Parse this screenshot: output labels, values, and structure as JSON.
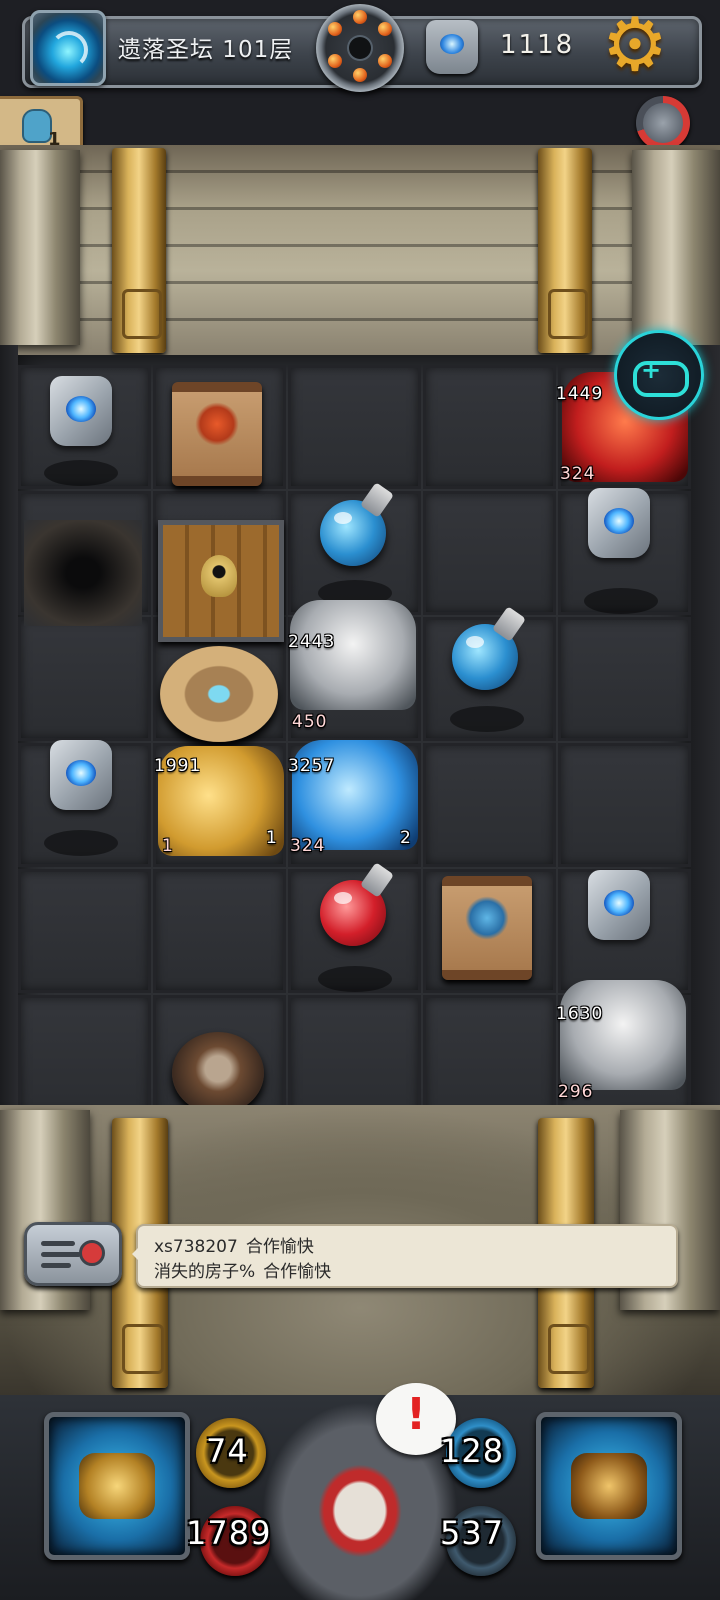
{
  "hud": {
    "floor_title": "遗落圣坛 101层",
    "coins": "1118",
    "party_count": "1"
  },
  "board": {
    "monsters": [
      {
        "id": "red-demon",
        "hp": "1449",
        "atk": "324"
      },
      {
        "id": "grey-ghost-top",
        "hp": "2443",
        "atk": "450"
      },
      {
        "id": "golden-golem",
        "hp": "1991",
        "atk": "1",
        "level": "1"
      },
      {
        "id": "ice-wraith",
        "hp": "3257",
        "atk": "324",
        "level": "2"
      },
      {
        "id": "grey-ghost-bottom",
        "hp": "1630",
        "atk": "296"
      }
    ]
  },
  "chat": {
    "messages": [
      {
        "name": "xs738207",
        "text": "合作愉快"
      },
      {
        "name": "消失的房子%",
        "text": "合作愉快"
      }
    ]
  },
  "stats": {
    "attack": "74",
    "hp": "1789",
    "defense": "128",
    "gold": "537"
  },
  "alert": "!",
  "icons": {
    "portal": "portal-icon",
    "bomb": "bomb-icon",
    "rune": "rune-stone-icon",
    "settings": "gear-icon",
    "gamepad": "gamepad-icon",
    "chat": "chat-icon",
    "weapon_slot": "knight-helmet-icon",
    "spell_slot": "spellbook-icon"
  },
  "colors": {
    "hud_bg": "#3d434b",
    "gold_accent": "#e8a82a",
    "hp_red": "#c2262b",
    "cyan_accent": "#2ad3d9"
  }
}
